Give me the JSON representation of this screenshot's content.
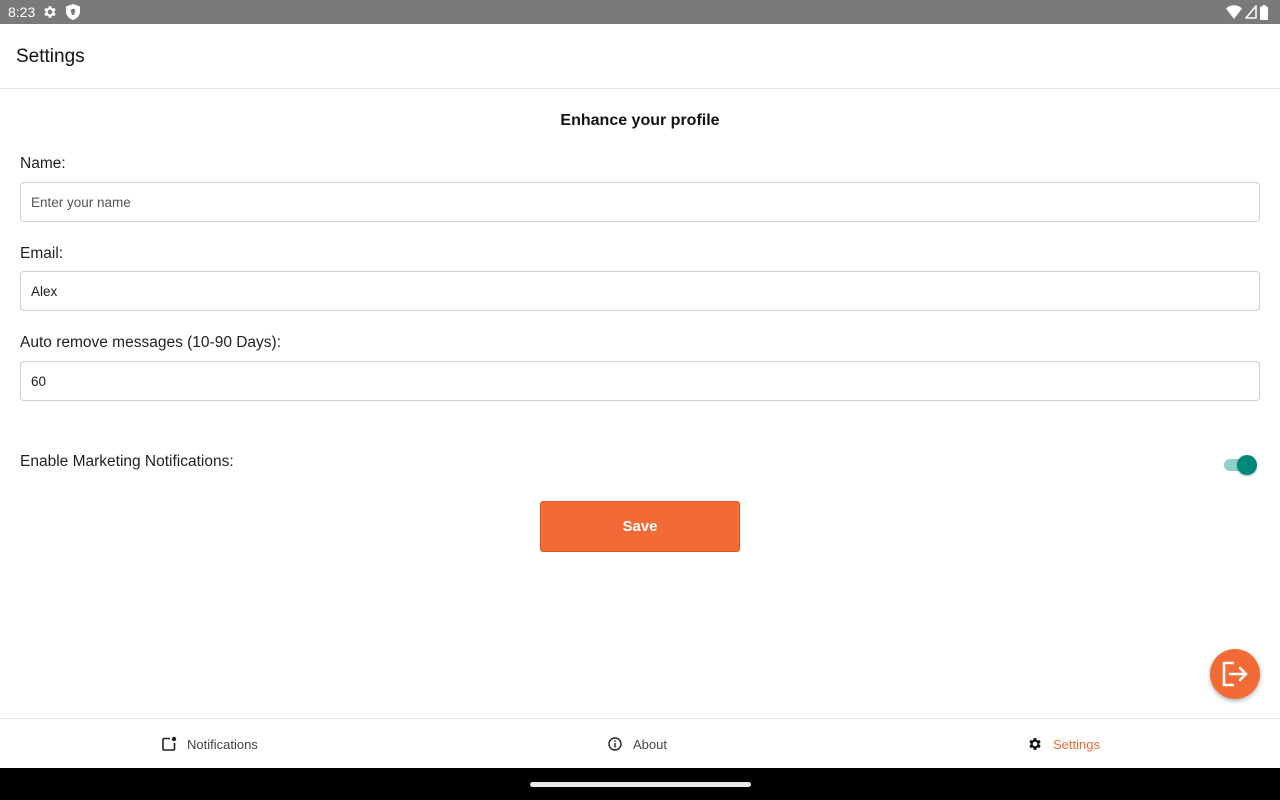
{
  "status_bar": {
    "time": "8:23"
  },
  "app_bar": {
    "title": "Settings"
  },
  "form": {
    "heading": "Enhance your profile",
    "name": {
      "label": "Name:",
      "value": "",
      "placeholder": "Enter your name"
    },
    "email": {
      "label": "Email:",
      "value": "Alex"
    },
    "auto_remove": {
      "label": "Auto remove messages (10-90 Days):",
      "value": "60"
    },
    "marketing": {
      "label": "Enable Marketing Notifications:",
      "enabled": true
    },
    "save_label": "Save"
  },
  "bottom_nav": {
    "items": [
      {
        "label": "Notifications",
        "icon": "notification-badge-icon",
        "active": false
      },
      {
        "label": "About",
        "icon": "info-icon",
        "active": false
      },
      {
        "label": "Settings",
        "icon": "gear-icon",
        "active": true
      }
    ]
  },
  "colors": {
    "accent": "#f26a35",
    "toggle_on": "#00897b",
    "status_bar": "#7a7a7a"
  }
}
